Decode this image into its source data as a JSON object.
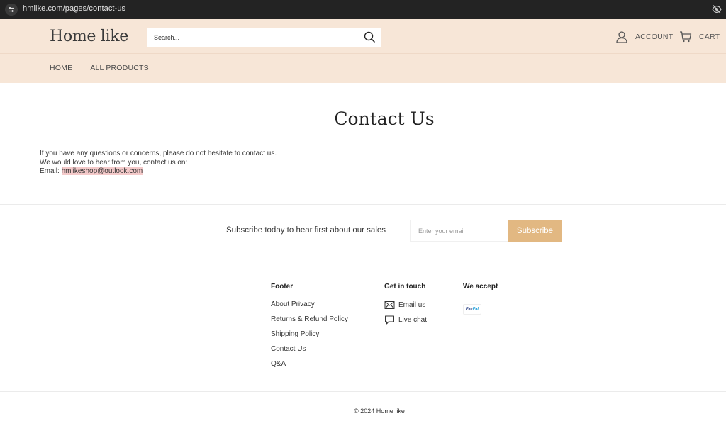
{
  "browser": {
    "url": "hmlike.com/pages/contact-us",
    "icons": [
      "site-settings-icon",
      "eye-off-icon"
    ]
  },
  "header": {
    "logo": "Home like",
    "search": {
      "placeholder": "Search...",
      "icon": "search-icon"
    },
    "account_label": "ACCOUNT",
    "cart_label": "CART",
    "nav": [
      {
        "label": "HOME"
      },
      {
        "label": "ALL PRODUCTS"
      }
    ]
  },
  "main": {
    "title": "Contact Us",
    "lines": [
      "If you have any questions or concerns, please do not hesitate to contact us.",
      "We would love to hear from you, contact us on:"
    ],
    "email_prefix": "Email: ",
    "email": "hmlikeshop@outlook.com"
  },
  "subscribe": {
    "text": "Subscribe today to hear first about our sales",
    "placeholder": "Enter your email",
    "button": "Subscribe",
    "button_color": "#e2b882"
  },
  "footer": {
    "columns": [
      {
        "heading": "Footer",
        "links": [
          "About Privacy",
          "Returns & Refund Policy",
          "Shipping Policy",
          "Contact Us",
          "Q&A"
        ]
      },
      {
        "heading": "Get in touch",
        "links": [
          {
            "label": "Email us",
            "icon": "mail-icon"
          },
          {
            "label": "Live chat",
            "icon": "chat-icon"
          }
        ]
      },
      {
        "heading": "We accept",
        "payment": {
          "pay": "Pay",
          "pal": "Pal"
        }
      }
    ],
    "copyright": "© 2024 Home like"
  },
  "colors": {
    "header_bg": "#f7e6d7",
    "email_highlight": "#f4caca",
    "browser_bar": "#232323"
  }
}
